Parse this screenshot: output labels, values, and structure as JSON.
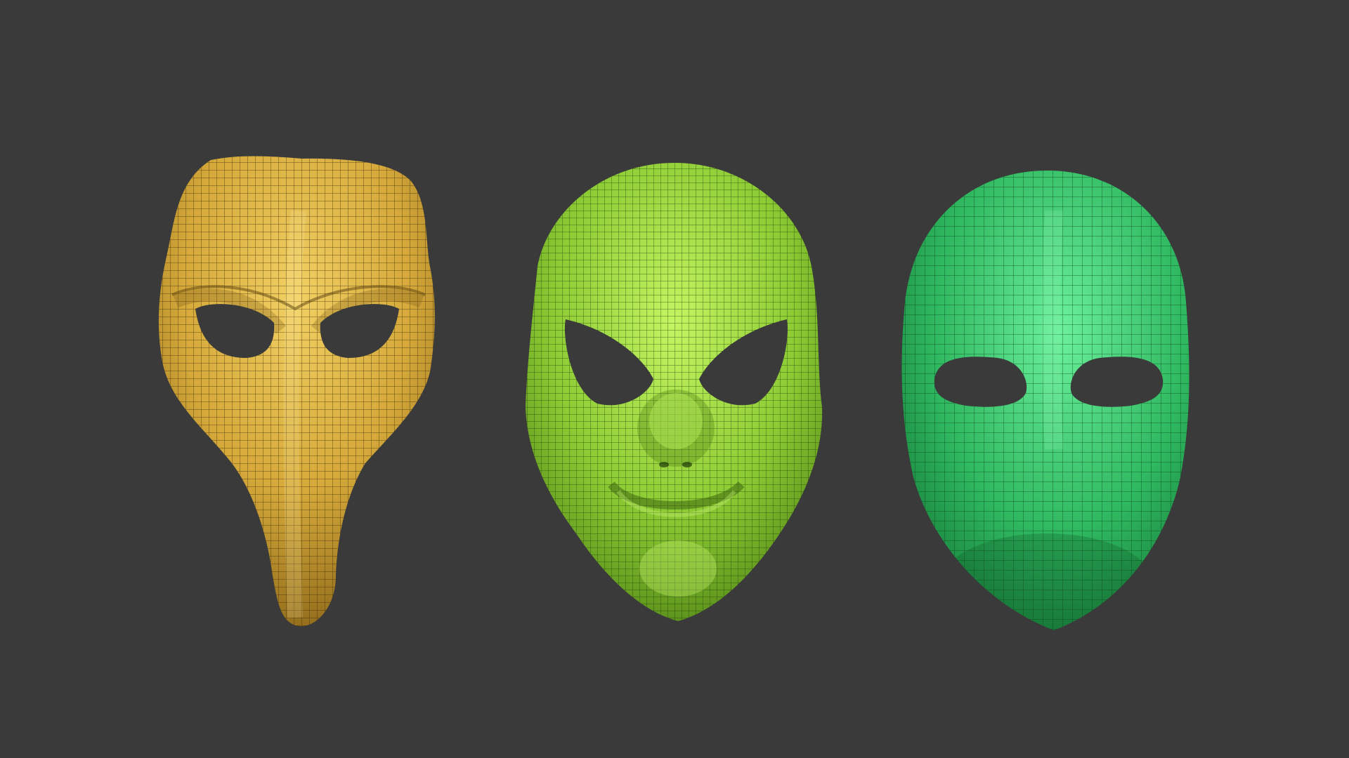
{
  "scene": {
    "background_color": "#3a3a3a",
    "masks": [
      {
        "name": "plague-doctor-mask",
        "style": "beaked",
        "fill_light": "#e8c250",
        "fill_dark": "#a77f22",
        "wire_color": "#3d2a08"
      },
      {
        "name": "grinning-face-mask",
        "style": "smiling face",
        "fill_light": "#b7ec55",
        "fill_dark": "#5f9a1c",
        "wire_color": "#1f3a08"
      },
      {
        "name": "blank-oval-mask",
        "style": "plain oval",
        "fill_light": "#5fe88f",
        "fill_dark": "#168a3c",
        "wire_color": "#073a18"
      }
    ]
  }
}
